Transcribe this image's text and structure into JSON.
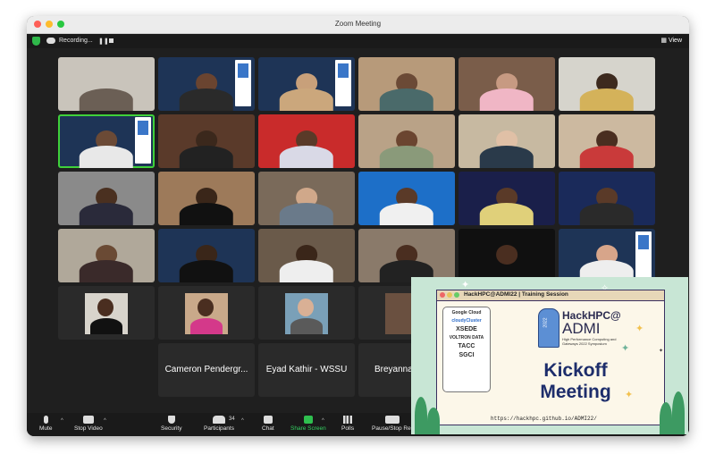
{
  "window": {
    "title": "Zoom Meeting"
  },
  "topbar": {
    "recording": "Recording...",
    "view": "View"
  },
  "name_tiles": [
    "Cameron Pendergr...",
    "Eyad Kathir - WSSU",
    "Breyanna"
  ],
  "toolbar": {
    "mute": "Mute",
    "stop_video": "Stop Video",
    "security": "Security",
    "participants": "Participants",
    "participants_count": "34",
    "chat": "Chat",
    "share_screen": "Share Screen",
    "polls": "Polls",
    "pause_recording": "Pause/Stop Rec"
  },
  "slide": {
    "bar_text": "HackHPC@ADMI22 | Training Session",
    "sponsors": [
      "Google Cloud",
      "cloudyCluster",
      "XSEDE",
      "VOLTRON DATA",
      "TACC",
      "SGCI"
    ],
    "hack": "HackHPC@",
    "admi": "ADMI",
    "symposium": "High Performance Computing and Gateways 2022 Symposium",
    "title_line1": "Kickoff",
    "title_line2": "Meeting",
    "url": "https://hackhpc.github.io/ADMI22/"
  },
  "colors": {
    "accent_green": "#35d162",
    "window_bg": "#1f1f1f",
    "active_border": "#3fd13a"
  }
}
